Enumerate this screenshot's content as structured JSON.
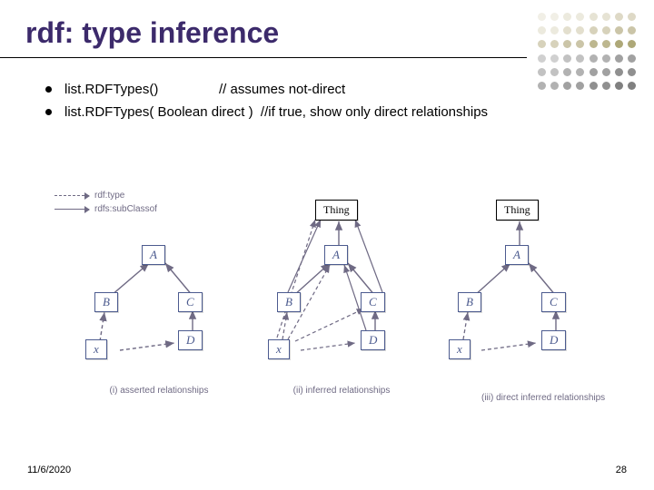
{
  "title": "rdf: type inference",
  "bullets": [
    {
      "seg1": "list.RDFTypes()",
      "seg2": "// assumes not-direct"
    },
    {
      "seg1": "list.RDFTypes( Boolean direct )",
      "seg2": "//if true, show only direct relationships"
    }
  ],
  "legend": {
    "dashed_label": "rdf:type",
    "solid_label": "rdfs:subClassof"
  },
  "nodes": {
    "thing": "Thing",
    "A": "A",
    "B": "B",
    "C": "C",
    "D": "D",
    "x": "x"
  },
  "captions": {
    "p1": "(i) asserted relationships",
    "p2": "(ii) inferred relationships",
    "p3": "(iii) direct inferred relationships"
  },
  "footer_left": "11/6/2020",
  "footer_right": "28",
  "dot_colors": {
    "row0": "#e9e7de",
    "row0b": "#d7d4c6",
    "olive": "#b7b38b",
    "olive2": "#9e9a6e",
    "grey": "#bcbcbc",
    "grey2": "#9f9f9f"
  }
}
